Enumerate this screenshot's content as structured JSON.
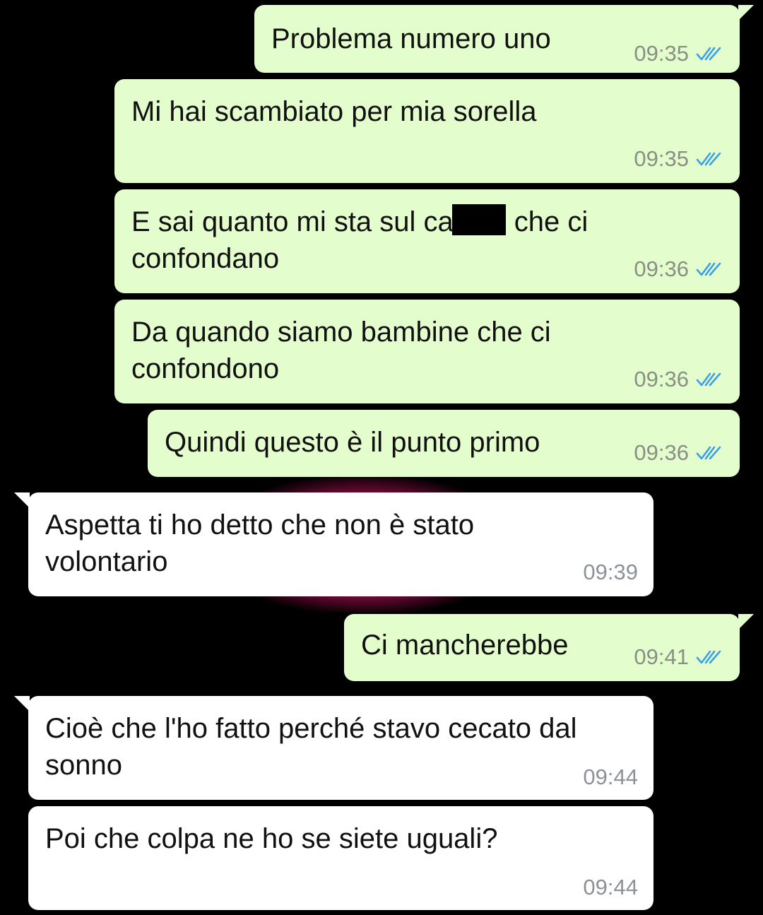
{
  "messages": [
    {
      "direction": "outgoing",
      "text": "Problema numero uno",
      "time": "09:35",
      "status": "read"
    },
    {
      "direction": "outgoing",
      "text": "Mi hai scambiato per mia sorella",
      "time": "09:35",
      "status": "read"
    },
    {
      "direction": "outgoing",
      "text_before": "E sai quanto mi sta sul ca",
      "text_after": "che ci\nconfondano",
      "redacted": true,
      "time": "09:36",
      "status": "read"
    },
    {
      "direction": "outgoing",
      "text": "Da quando siamo bambine che ci\nconfondono",
      "time": "09:36",
      "status": "read"
    },
    {
      "direction": "outgoing",
      "text": "Quindi questo è il punto primo",
      "time": "09:36",
      "status": "read"
    },
    {
      "direction": "incoming",
      "text": "Aspetta ti ho detto che non è stato\nvolontario",
      "time": "09:39"
    },
    {
      "direction": "outgoing",
      "text": "Ci mancherebbe",
      "time": "09:41",
      "status": "read"
    },
    {
      "direction": "incoming",
      "text": "Cioè che l'ho fatto perché stavo cecato dal\nsonno",
      "time": "09:44"
    },
    {
      "direction": "incoming",
      "text": "Poi che colpa ne ho se siete uguali?",
      "time": "09:44"
    }
  ],
  "icons": {
    "read_receipt": "double-check-icon"
  },
  "colors": {
    "background": "#000000",
    "outgoing_bubble": "#e4fdcc",
    "incoming_bubble": "#ffffff",
    "read_tick": "#3aa0e8",
    "timestamp": "#8a8f86"
  }
}
